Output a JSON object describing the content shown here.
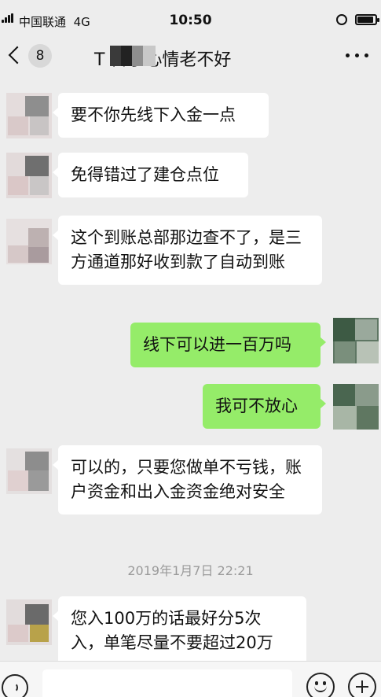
{
  "status_bar": {
    "carrier": "中国联通",
    "network": "4G",
    "time": "10:50"
  },
  "header": {
    "back_count": "8",
    "title": "T        日子心情老不好"
  },
  "messages": [
    {
      "side": "left",
      "text": "要不你先线下入金一点"
    },
    {
      "side": "left",
      "text": "免得错过了建仓点位"
    },
    {
      "side": "left",
      "text": "这个到账总部那边查不了，是三方通道那好收到款了自动到账"
    },
    {
      "side": "right",
      "text": "线下可以进一百万吗"
    },
    {
      "side": "right",
      "text": "我可不放心"
    },
    {
      "side": "left",
      "text": "可以的，只要您做单不亏钱，账户资金和出入金资金绝对安全"
    },
    {
      "side": "left",
      "text": "您入100万的话最好分5次入，单笔尽量不要超过20万"
    }
  ],
  "timestamp": "2019年1月7日 22:21",
  "input_bar": {
    "voice_icon": "voice-icon",
    "emoji_icon": "emoji-icon",
    "add_icon": "plus-icon",
    "placeholder": ""
  },
  "colors": {
    "background": "#ededed",
    "incoming_bubble": "#ffffff",
    "outgoing_bubble": "#95ec69",
    "timestamp_text": "#9a9a9a"
  }
}
